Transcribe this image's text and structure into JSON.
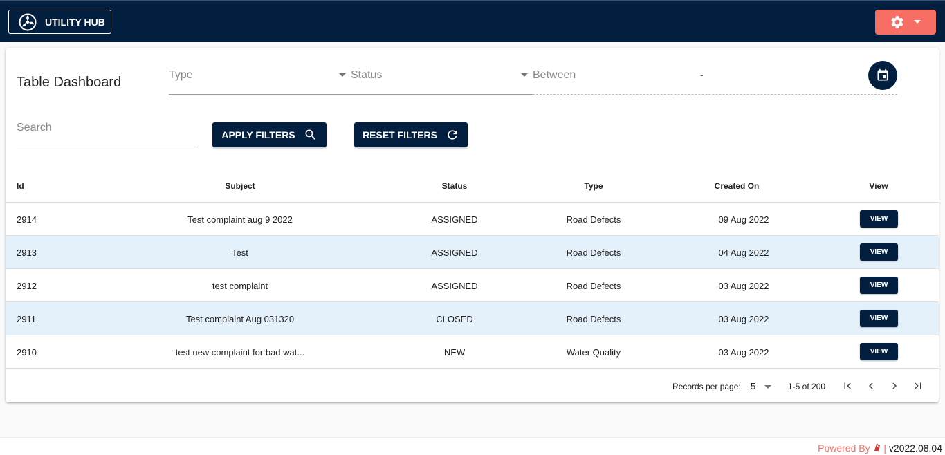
{
  "header": {
    "brand_label": "UTILITY HUB",
    "icons": {
      "brand": "utility-logo-icon",
      "settings": "gear-icon",
      "dropdown": "caret-down-icon"
    },
    "colors": {
      "topbar": "#021f3f",
      "accent": "#f76e64"
    }
  },
  "dashboard": {
    "title": "Table Dashboard",
    "filters": {
      "type_placeholder": "Type",
      "status_placeholder": "Status",
      "between_placeholder": "Between",
      "range_separator": "-",
      "search_placeholder": "Search"
    },
    "buttons": {
      "apply": "APPLY FILTERS",
      "reset": "RESET FILTERS"
    }
  },
  "table": {
    "headers": {
      "id": "Id",
      "subject": "Subject",
      "status": "Status",
      "type": "Type",
      "created": "Created On",
      "view": "View"
    },
    "rows": [
      {
        "id": "2914",
        "subject": "Test complaint aug 9 2022",
        "status": "ASSIGNED",
        "type": "Road Defects",
        "created": "09 Aug 2022",
        "action": "VIEW"
      },
      {
        "id": "2913",
        "subject": "Test",
        "status": "ASSIGNED",
        "type": "Road Defects",
        "created": "04 Aug 2022",
        "action": "VIEW"
      },
      {
        "id": "2912",
        "subject": "test complaint",
        "status": "ASSIGNED",
        "type": "Road Defects",
        "created": "03 Aug 2022",
        "action": "VIEW"
      },
      {
        "id": "2911",
        "subject": "Test complaint Aug 031320",
        "status": "CLOSED",
        "type": "Road Defects",
        "created": "03 Aug 2022",
        "action": "VIEW"
      },
      {
        "id": "2910",
        "subject": "test new complaint for bad wat...",
        "status": "NEW",
        "type": "Water Quality",
        "created": "03 Aug 2022",
        "action": "VIEW"
      }
    ]
  },
  "pagination": {
    "records_label": "Records per page:",
    "per_page": "5",
    "range": "1-5 of 200"
  },
  "footer": {
    "powered": "Powered By",
    "separator": "|",
    "version": "v2022.08.04"
  }
}
